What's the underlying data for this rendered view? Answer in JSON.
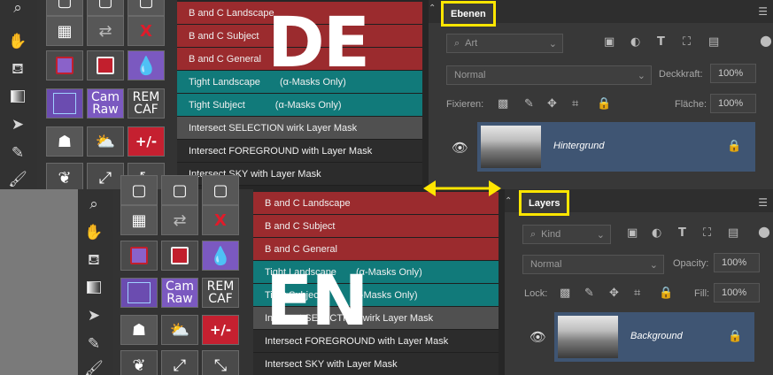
{
  "labels": {
    "de": "DE",
    "en": "EN"
  },
  "buttons": {
    "cam_raw_line1": "Cam",
    "cam_raw_line2": "Raw",
    "rem_caf_line1": "REM",
    "rem_caf_line2": "CAF",
    "plus_minus": "+/-",
    "x_label": "X"
  },
  "menu_de": {
    "items": [
      {
        "label": "B and C Landscape",
        "sub": ""
      },
      {
        "label": "B and C Subject",
        "sub": ""
      },
      {
        "label": "B and C General",
        "sub": ""
      },
      {
        "label": "Tight Landscape",
        "sub": "(α-Masks Only)"
      },
      {
        "label": "Tight Subject",
        "sub": "(α-Masks Only)"
      },
      {
        "label": "Intersect SELECTION wirk Layer Mask",
        "sub": ""
      },
      {
        "label": "Intersect FOREGROUND with Layer Mask",
        "sub": ""
      },
      {
        "label": "Intersect SKY with Layer Mask",
        "sub": ""
      }
    ]
  },
  "menu_en": {
    "items": [
      {
        "label": "B and C Landscape",
        "sub": ""
      },
      {
        "label": "B and C Subject",
        "sub": ""
      },
      {
        "label": "B and C General",
        "sub": ""
      },
      {
        "label": "Tight Landscape",
        "sub": "(α-Masks Only)"
      },
      {
        "label": "Tight Subject",
        "sub": "(α-Masks Only)"
      },
      {
        "label": "Intersect SELECTION wirk Layer Mask",
        "sub": ""
      },
      {
        "label": "Intersect FOREGROUND with Layer Mask",
        "sub": ""
      },
      {
        "label": "Intersect SKY with Layer Mask",
        "sub": ""
      }
    ]
  },
  "layers_de": {
    "tab": "Ebenen",
    "filter": "Art",
    "blend_mode": "Normal",
    "opacity_label": "Deckkraft:",
    "opacity_value": "100%",
    "lock_label": "Fixieren:",
    "fill_label": "Fläche:",
    "fill_value": "100%",
    "layer_name": "Hintergrund"
  },
  "layers_en": {
    "tab": "Layers",
    "filter": "Kind",
    "blend_mode": "Normal",
    "opacity_label": "Opacity:",
    "opacity_value": "100%",
    "lock_label": "Lock:",
    "fill_label": "Fill:",
    "fill_value": "100%",
    "layer_name": "Background"
  },
  "colors": {
    "menu_red": "#9b2b2e",
    "menu_teal": "#117a7a",
    "highlight_yellow": "#ffe600",
    "layer_selected": "#3f5573",
    "button_purple": "#7b59c0"
  },
  "icons": [
    "search-icon",
    "hand-icon",
    "bucket-icon",
    "gradient-icon",
    "arrow-icon",
    "brush-icon",
    "calculator-icon",
    "swap-icon",
    "eye-icon",
    "lock-icon",
    "double-arrow-icon",
    "menu-icon"
  ]
}
